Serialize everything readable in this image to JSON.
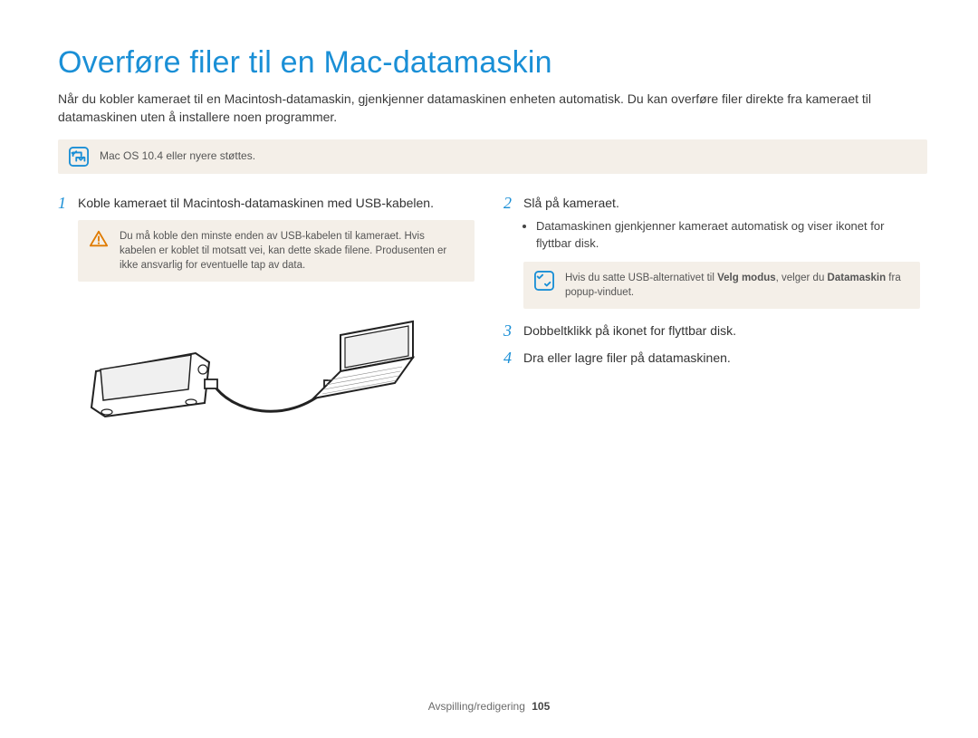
{
  "title": "Overføre filer til en Mac-datamaskin",
  "intro": "Når du kobler kameraet til en Macintosh-datamaskin, gjenkjenner datamaskinen enheten automatisk. Du kan overføre filer direkte fra kameraet til datamaskinen uten å installere noen programmer.",
  "top_note": "Mac OS 10.4 eller nyere støttes.",
  "left": {
    "step1_num": "1",
    "step1_text": "Koble kameraet til Macintosh-datamaskinen med USB-kabelen.",
    "caution_text": "Du må koble den minste enden av USB-kabelen til kameraet. Hvis kabelen er koblet til motsatt vei, kan dette skade filene. Produsenten er ikke ansvarlig for eventuelle tap av data."
  },
  "right": {
    "step2_num": "2",
    "step2_text": "Slå på kameraet.",
    "bullet1": "Datamaskinen gjenkjenner kameraet automatisk og viser ikonet for flyttbar disk.",
    "note2_prefix": "Hvis du satte USB-alternativet til ",
    "note2_bold1": "Velg modus",
    "note2_mid": ", velger du ",
    "note2_bold2": "Datamaskin",
    "note2_suffix": " fra popup-vinduet.",
    "step3_num": "3",
    "step3_text": "Dobbeltklikk på ikonet for flyttbar disk.",
    "step4_num": "4",
    "step4_text": "Dra eller lagre filer på datamaskinen."
  },
  "footer_section": "Avspilling/redigering",
  "footer_page": "105"
}
